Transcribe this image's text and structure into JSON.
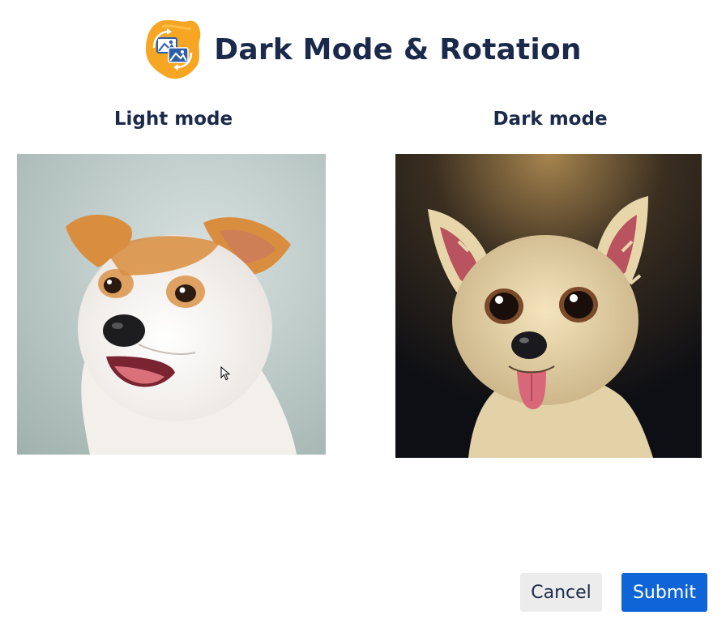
{
  "header": {
    "title": "Dark Mode & Rotation",
    "logo_icon": "rotate-images-icon",
    "logo_color": "#f7a623"
  },
  "light": {
    "label": "Light mode",
    "image_icon": "dog-photo-light"
  },
  "dark": {
    "label": "Dark mode",
    "image_icon": "dog-illustration-dark"
  },
  "actions": {
    "cancel_label": "Cancel",
    "submit_label": "Submit"
  },
  "colors": {
    "text": "#1b2a4a",
    "primary": "#0f64d8",
    "cancel_bg": "#ececec"
  }
}
